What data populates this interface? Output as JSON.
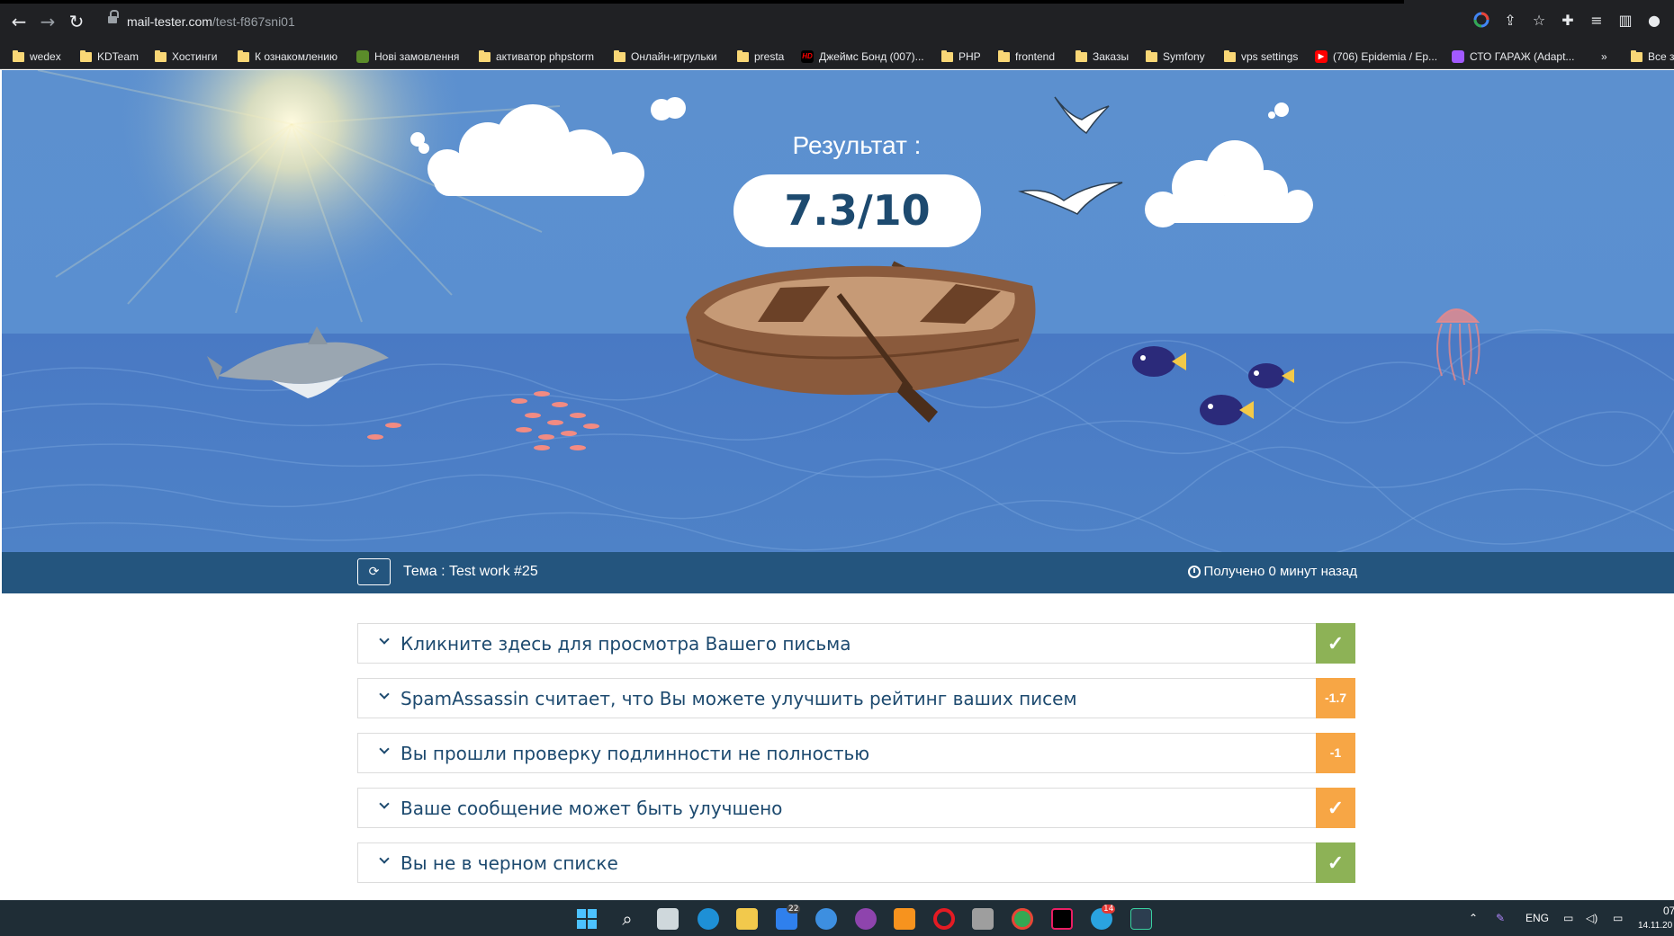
{
  "browser": {
    "url_host": "mail-tester.com",
    "url_path": "/test-f867sni01",
    "bookmarks": [
      {
        "label": "wedex",
        "icon": "folder-icon"
      },
      {
        "label": "KDTeam",
        "icon": "folder-icon"
      },
      {
        "label": "Хостинги",
        "icon": "folder-icon"
      },
      {
        "label": "К ознакомлению",
        "icon": "folder-icon"
      },
      {
        "label": "Нові замовлення",
        "icon": "shop-icon"
      },
      {
        "label": "активатор phpstorm",
        "icon": "folder-icon"
      },
      {
        "label": "Онлайн-игрульки",
        "icon": "folder-icon"
      },
      {
        "label": "presta",
        "icon": "folder-icon"
      },
      {
        "label": "Джеймс Бонд (007)...",
        "icon": "hd-icon"
      },
      {
        "label": "PHP",
        "icon": "folder-icon"
      },
      {
        "label": "frontend",
        "icon": "folder-icon"
      },
      {
        "label": "Заказы",
        "icon": "folder-icon"
      },
      {
        "label": "Symfony",
        "icon": "folder-icon"
      },
      {
        "label": "vps settings",
        "icon": "folder-icon"
      },
      {
        "label": "(706) Epidemia / Ep...",
        "icon": "youtube-icon"
      },
      {
        "label": "СТО ГАРАЖ (Adapt...",
        "icon": "figma-icon"
      }
    ],
    "bookmarks_more": "»",
    "bookmarks_all": "Все з",
    "hd_text": "HD"
  },
  "hero": {
    "result_label": "Результат :",
    "score": "7.3/10"
  },
  "infobar": {
    "subject": "Тема : Test work #25",
    "received": "Получено 0 минут назад"
  },
  "results": [
    {
      "text": "Кликните здесь для просмотра Вашего письма",
      "badge": "✓",
      "color": "#8db256"
    },
    {
      "text": "SpamAssassin считает, что Вы можете улучшить рейтинг ваших писем",
      "badge": "-1.7",
      "color": "#f7a645"
    },
    {
      "text": "Вы прошли проверку подлинности не полностью",
      "badge": "-1",
      "color": "#f7a645"
    },
    {
      "text": "Ваше сообщение может быть улучшено",
      "badge": "✓",
      "color": "#f7a645"
    },
    {
      "text": "Вы не в черном списке",
      "badge": "✓",
      "color": "#8db256"
    }
  ],
  "taskbar": {
    "mail_badge": "22",
    "telegram_badge": "14",
    "lang": "ENG",
    "time": "07",
    "date": "14.11.20"
  }
}
